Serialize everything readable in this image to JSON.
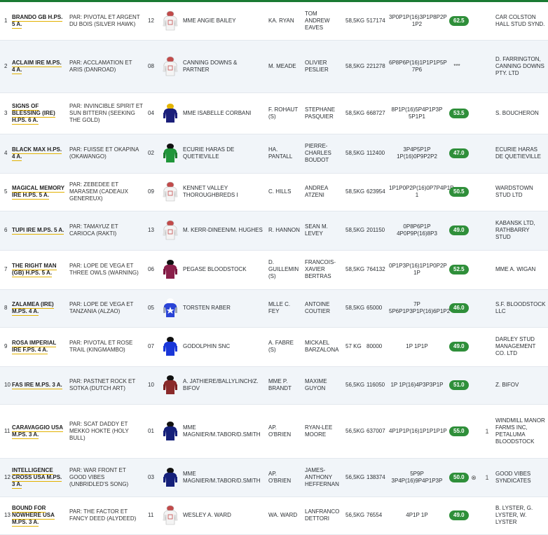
{
  "colors": {
    "accent_bar": "#1a7a32",
    "rating_badge": "#2f8f3a",
    "name_underline": "#e2b100",
    "alt_row": "#f1f5f9"
  },
  "runners": [
    {
      "num": "1",
      "name": "BRANDO GB H.PS. 5 A.",
      "pedigree": "Par: PIVOTAL et ARGENT DU BOIS (SILVER HAWK)",
      "draw": "12",
      "silk": "grey-white",
      "owner": "MME ANGIE BAILEY",
      "jockey": "KA. RYAN",
      "trainer": "TOM ANDREW EAVES",
      "weight": "58,5kg",
      "earnings": "517174",
      "music": "3p0p1p(16)3p1p8p2p 1p2",
      "rating": "62.5",
      "extra1": "",
      "extra2": "",
      "breeder": "CAR COLSTON HALL STUD SYND."
    },
    {
      "num": "2",
      "name": "ACLAIM IRE M.PS. 4 A.",
      "pedigree": "Par: ACCLAMATION et ARIS (DANROAD)",
      "draw": "08",
      "silk": "grey-white",
      "owner": "CANNING DOWNS & PARTNER",
      "jockey": "M. MEADE",
      "trainer": "Olivier PESLIER",
      "weight": "58,5kg",
      "earnings": "221278",
      "music": "6p8p6p(16)1p1p1p5p 7p6",
      "rating": "***",
      "extra1": "",
      "extra2": "",
      "breeder": "D. FARRINGTON, CANNING DOWNS PTY. LTD"
    },
    {
      "num": "3",
      "name": "SIGNS OF BLESSING (IRE) H.PS. 6 A.",
      "pedigree": "Par: INVINCIBLE SPIRIT et SUN BITTERN (SEEKING THE GOLD)",
      "draw": "04",
      "silk": "navy-gold",
      "owner": "MME ISABELLE CORBANI",
      "jockey": "F. ROHAUT (S)",
      "trainer": "STEPHANE PASQUIER",
      "weight": "58,5kg",
      "earnings": "668727",
      "music": "8p1p(16)5p4p1p3p 5p1p1",
      "rating": "53.5",
      "extra1": "",
      "extra2": "",
      "breeder": "S. BOUCHERON"
    },
    {
      "num": "4",
      "name": "Black Max H.Ps. 4 A.",
      "pedigree": "Par: FUISSE et OKAPINA (OKAWANGO)",
      "draw": "02",
      "silk": "green",
      "owner": "ECURIE HARAS DE QUETIEVILLE",
      "jockey": "HA. PANTALL",
      "trainer": "PIERRE-CHARLES BOUDOT",
      "weight": "58,5kg",
      "earnings": "112400",
      "music": "3p4p5p1p 1p(16)0p9p2p2",
      "rating": "47.0",
      "extra1": "",
      "extra2": "",
      "breeder": "ECURIE HARAS DE QUETIEVILLE"
    },
    {
      "num": "5",
      "name": "MAGICAL MEMORY IRE H.PS. 5 A.",
      "pedigree": "Par: ZEBEDEE et MARASEM (CADEAUX GENEREUX)",
      "draw": "09",
      "silk": "grey-white",
      "owner": "KENNET VALLEY THOROUGHBREDS I",
      "jockey": "C. HILLS",
      "trainer": "ANDREA ATZENI",
      "weight": "58,5kg",
      "earnings": "623954",
      "music": "1p1p0p2p(16)0p7p4p1p 1",
      "rating": "50.5",
      "extra1": "",
      "extra2": "",
      "breeder": "WARDSTOWN STUD LTD"
    },
    {
      "num": "6",
      "name": "TUPI IRE M.PS. 5 A.",
      "pedigree": "Par: TAMAYUZ et CARIOCA (RAKTI)",
      "draw": "13",
      "silk": "grey-white",
      "owner": "M. KERR-DINEEN/M. HUGHES",
      "jockey": "R. HANNON",
      "trainer": "SEAN M. LEVEY",
      "weight": "58,5kg",
      "earnings": "201150",
      "music": "0p8p6p1p 4p0p9p(16)8p3",
      "rating": "49.0",
      "extra1": "",
      "extra2": "",
      "breeder": "KABANSK LTD, RATHBARRY STUD"
    },
    {
      "num": "7",
      "name": "THE RIGHT MAN (GB) H.PS. 5 A.",
      "pedigree": "Par: LOPE DE VEGA et THREE OWLS (WARNING)",
      "draw": "06",
      "silk": "maroon",
      "owner": "PEGASE BLOODSTOCK",
      "jockey": "D. GUILLEMIN (S)",
      "trainer": "FRANCOIS-XAVIER BERTRAS",
      "weight": "58,5kg",
      "earnings": "764132",
      "music": "0p1p3p(16)1p1p0p2p 1p",
      "rating": "52.5",
      "extra1": "",
      "extra2": "",
      "breeder": "MME A. WIGAN"
    },
    {
      "num": "8",
      "name": "ZALAMEA (IRE) M.PS. 4 a.",
      "pedigree": "Par: LOPE DE VEGA et TANZANIA (ALZAO)",
      "draw": "05",
      "silk": "blue-star",
      "owner": "TORSTEN RABER",
      "jockey": "MLLE C. FEY",
      "trainer": "ANTOINE COUTIER",
      "weight": "58,5kg",
      "earnings": "65000",
      "music": "7p 5p6p1p3p1p(16)6p1p2",
      "rating": "46.0",
      "extra1": "",
      "extra2": "",
      "breeder": "S.F. BLOODSTOCK LLC"
    },
    {
      "num": "9",
      "name": "ROSA IMPERIAL IRE F.PS. 4 A.",
      "pedigree": "Par: PIVOTAL et ROSE TRAIL (KINGMAMBO)",
      "draw": "07",
      "silk": "royal-blue",
      "owner": "GODOLPHIN SNC",
      "jockey": "A. FABRE (S)",
      "trainer": "MICKAEL BARZALONA",
      "weight": "57 kg",
      "earnings": "80000",
      "music": "1p 1p1p",
      "rating": "49.0",
      "extra1": "",
      "extra2": "",
      "breeder": "DARLEY STUD MANAGEMENT CO. LTD"
    },
    {
      "num": "10",
      "name": "FAS IRE M.PS. 3 A.",
      "pedigree": "Par: PASTNET ROCK et SOTKA (DUTCH ART)",
      "draw": "10",
      "silk": "brown-red",
      "owner": "A. JATHIERE/BALLYLINCH/Z. BIFOV",
      "jockey": "MME P. BRANDT",
      "trainer": "MAXIME GUYON",
      "weight": "56,5kg",
      "earnings": "116050",
      "music": "1p 1p(16)4p3p3p1p",
      "rating": "51.0",
      "extra1": "",
      "extra2": "",
      "breeder": "Z. BIFOV"
    },
    {
      "num": "11",
      "name": "CARAVAGGIO USA M.PS. 3 A.",
      "pedigree": "Par: SCAT DADDY et MEKKO HOKTE (HOLY BULL)",
      "draw": "01",
      "silk": "navy",
      "owner": "MME MAGNIER/M.TABOR/D.SMITH",
      "jockey": "AP. O'BRIEN",
      "trainer": "RYAN-LEE MOORE",
      "weight": "56,5kg",
      "earnings": "637007",
      "music": "4p1p1p(16)1p1p1p1p",
      "rating": "55.0",
      "extra1": "",
      "extra2": "1",
      "breeder": "WINDMILL MANOR FARMS INC, PETALUMA BLOODSTOCK"
    },
    {
      "num": "12",
      "name": "INTELLIGENCE CROSS USA M.PS. 3 A.",
      "pedigree": "Par: WAR FRONT et GOOD VIBES (UNBRIDLED'S SONG)",
      "draw": "03",
      "silk": "navy",
      "owner": "MME MAGNIER/M.TABOR/D.SMITH",
      "jockey": "AP. O'BRIEN",
      "trainer": "JAMES-ANTHONY HEFFERNAN",
      "weight": "56,5kg",
      "earnings": "138374",
      "music": "5p9p 3p4p(16)9p4p1p3p",
      "rating": "50.0",
      "extra1": "⊗",
      "extra2": "1",
      "breeder": "GOOD VIBES SYNDICATES"
    },
    {
      "num": "13",
      "name": "BOUND FOR NOWHERE USA M.PS. 3 a.",
      "pedigree": "Par: THE FACTOR et FANCY DEED (ALYDEED)",
      "draw": "11",
      "silk": "grey-white",
      "owner": "WESLEY A. WARD",
      "jockey": "WA. WARD",
      "trainer": "LANFRANCO DETTORI",
      "weight": "56,5kg",
      "earnings": "76554",
      "music": "4p1p 1p",
      "rating": "49.0",
      "extra1": "",
      "extra2": "",
      "breeder": "B. LYSTER, G. LYSTER, W. LYSTER"
    }
  ]
}
